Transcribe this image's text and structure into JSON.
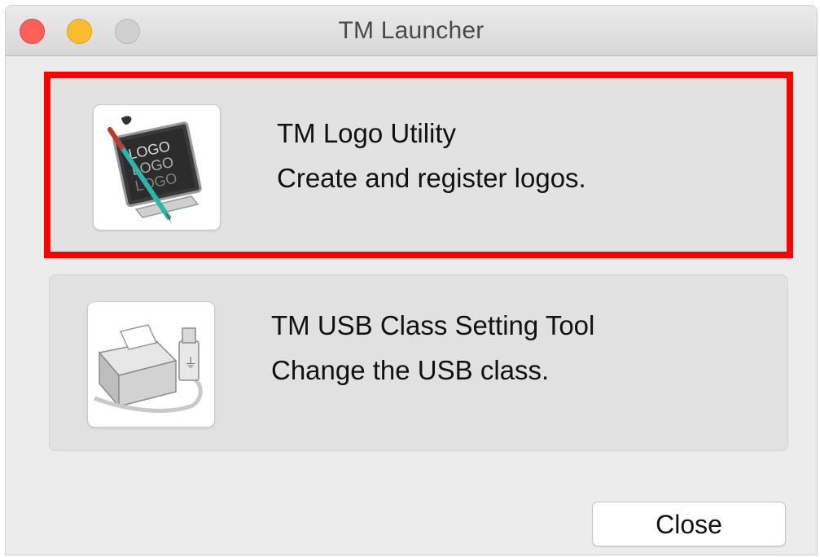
{
  "window": {
    "title": "TM Launcher"
  },
  "apps": [
    {
      "name": "TM Logo Utility",
      "description": "Create and register logos.",
      "icon": "logo-utility-icon",
      "highlighted": true,
      "highlight_color": "#ff0000",
      "icon_text": "LOGO"
    },
    {
      "name": "TM USB Class Setting Tool",
      "description": "Change the USB class.",
      "icon": "usb-printer-icon",
      "highlighted": false
    }
  ],
  "buttons": {
    "close_label": "Close"
  },
  "colors": {
    "traffic_close": "#fc5f57",
    "traffic_minimize": "#fdbc2e",
    "traffic_zoom_disabled": "#d0d0d0"
  }
}
